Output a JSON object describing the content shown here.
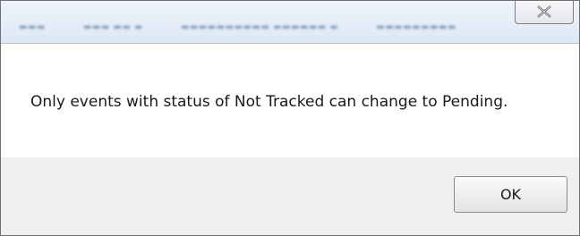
{
  "dialog": {
    "message": "Only events with status of Not Tracked can change to Pending.",
    "ok_label": "OK",
    "close_icon": "close-icon"
  },
  "colors": {
    "footer_bg": "#f0f0f0",
    "titlebar_bg": "#dde8f5",
    "text": "#1a1a1a"
  }
}
